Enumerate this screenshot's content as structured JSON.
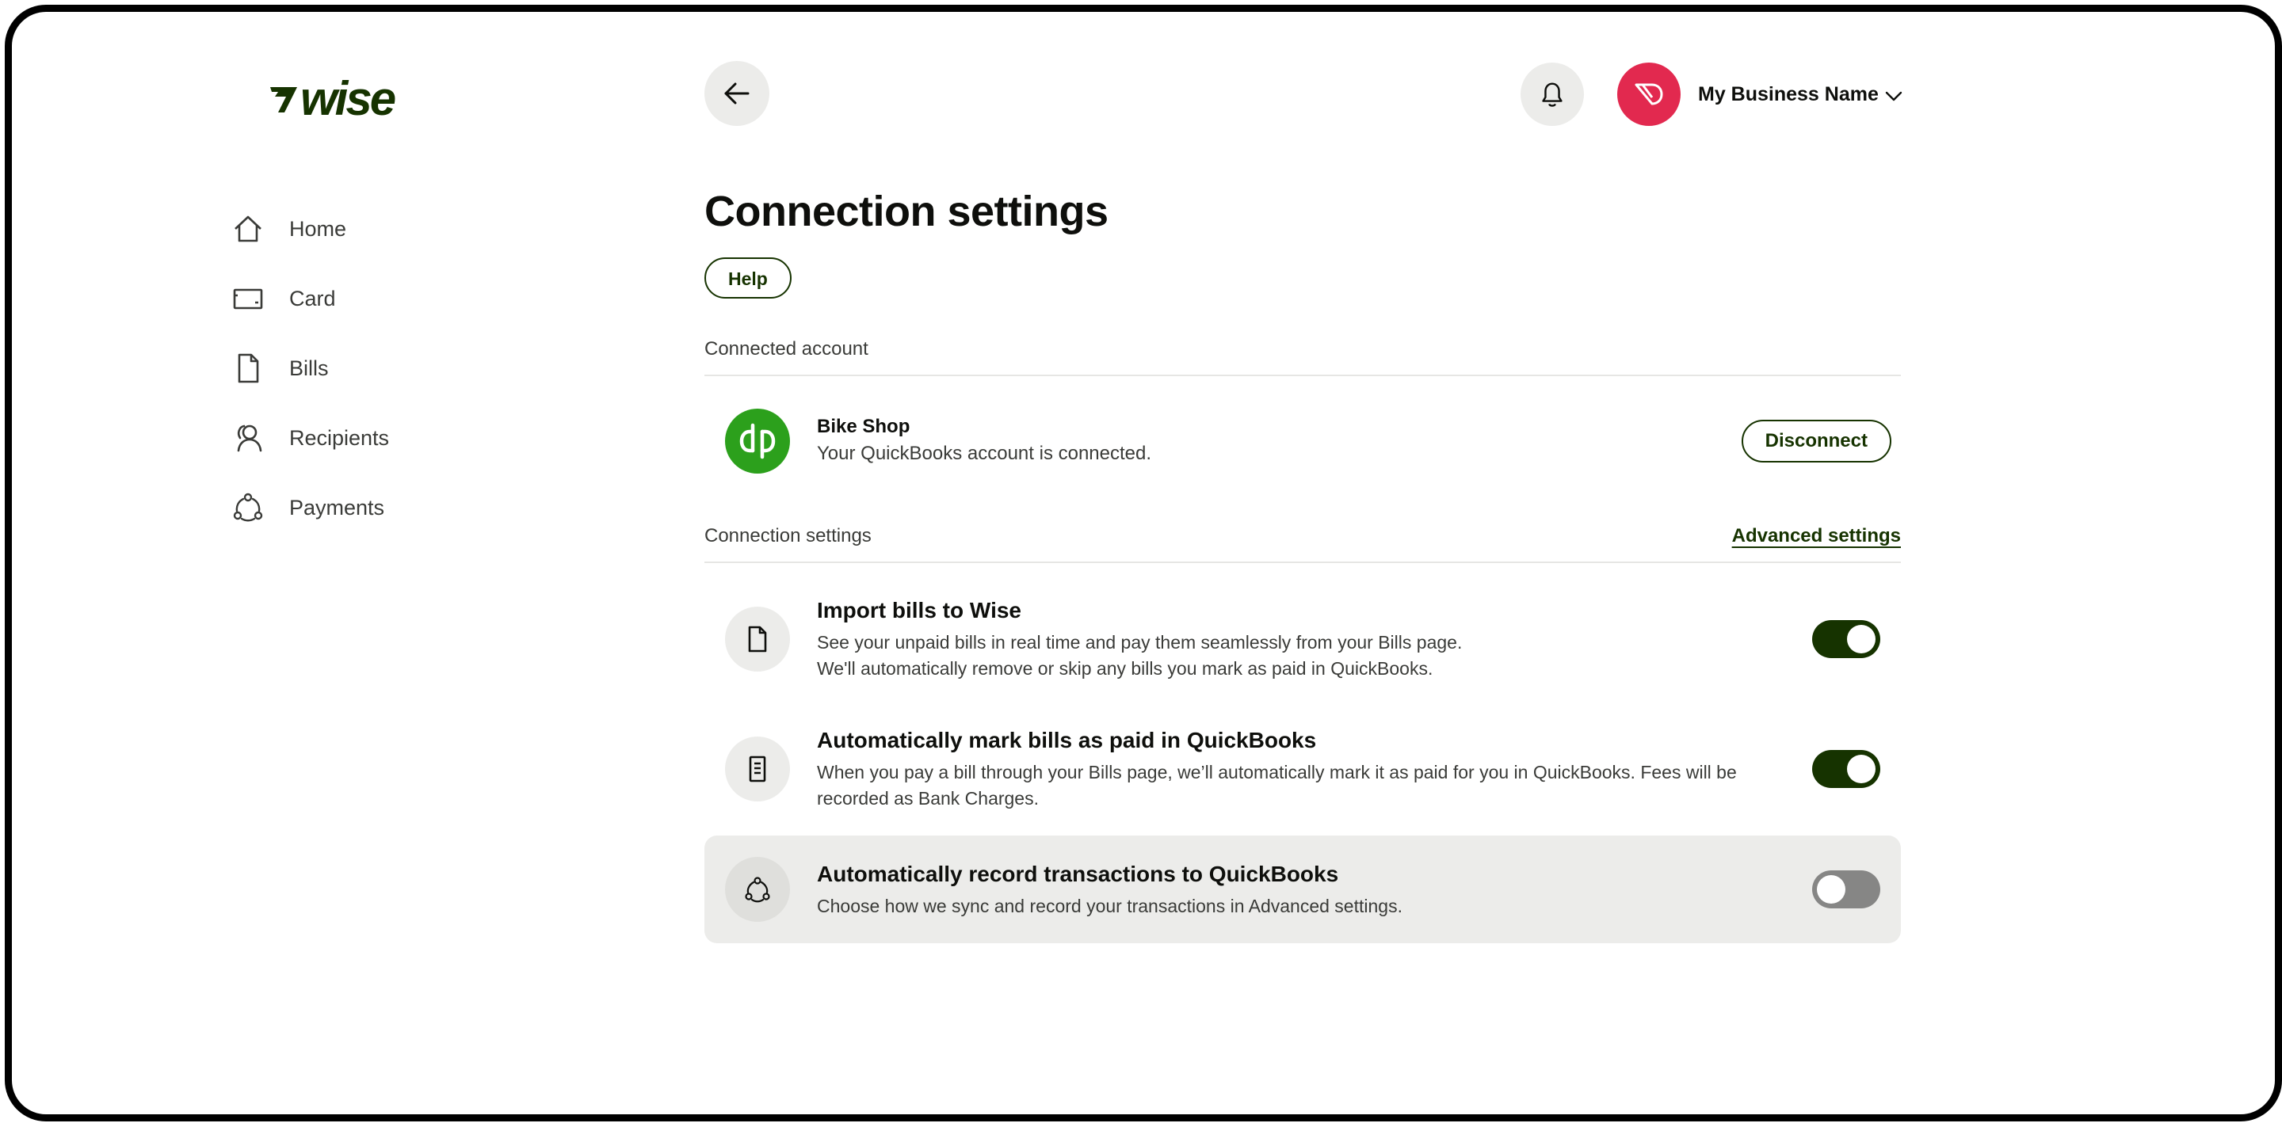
{
  "brand": {
    "logo_text": "wise",
    "accent": "#163300",
    "avatar_color": "#e2294f",
    "qb_color": "#2ca01c"
  },
  "sidebar": {
    "items": [
      {
        "label": "Home",
        "icon": "home-icon"
      },
      {
        "label": "Card",
        "icon": "card-icon"
      },
      {
        "label": "Bills",
        "icon": "bill-icon"
      },
      {
        "label": "Recipients",
        "icon": "recipients-icon"
      },
      {
        "label": "Payments",
        "icon": "payments-icon"
      }
    ]
  },
  "header": {
    "back_icon": "arrow-left-icon",
    "bell_icon": "bell-icon",
    "account_name": "My Business Name"
  },
  "main": {
    "title": "Connection settings",
    "help_label": "Help",
    "connected_account": {
      "heading": "Connected account",
      "name": "Bike Shop",
      "status": "Your QuickBooks account is connected.",
      "disconnect_label": "Disconnect"
    },
    "connection_settings": {
      "heading": "Connection settings",
      "advanced_link": "Advanced settings",
      "items": [
        {
          "title": "Import bills to Wise",
          "desc_line1": "See your unpaid bills in real time and pay them seamlessly from your Bills page.",
          "desc_line2": "We'll automatically remove or skip any bills you mark as paid in QuickBooks.",
          "enabled": true
        },
        {
          "title": "Automatically mark bills as paid in QuickBooks",
          "desc_line1": "When you pay a bill through your Bills page, we’ll automatically mark it as paid for you in QuickBooks. Fees will be recorded as Bank Charges.",
          "enabled": true
        },
        {
          "title": "Automatically record transactions to QuickBooks",
          "desc_line1": "Choose how we sync and record your transactions in Advanced settings.",
          "enabled": false
        }
      ]
    }
  }
}
